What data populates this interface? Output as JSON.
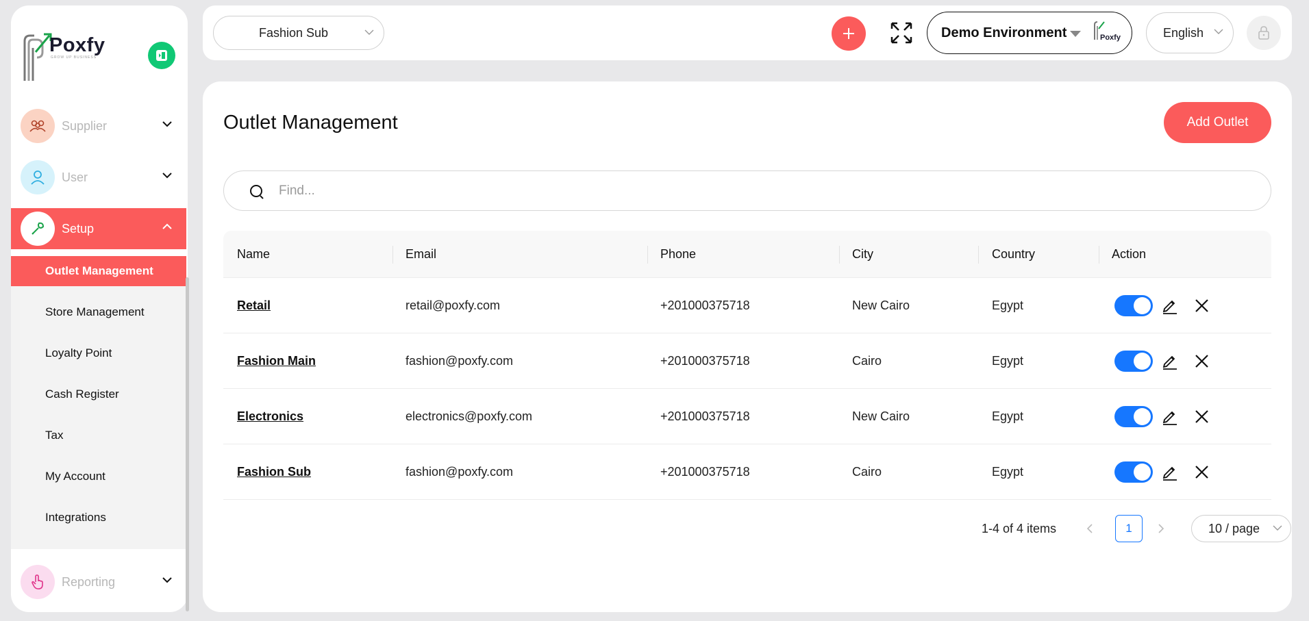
{
  "brand": {
    "name": "Poxfy",
    "tagline": "GROW UP BUSINESS"
  },
  "colors": {
    "accent": "#fb5b5b",
    "toggle_on": "#1677ff",
    "collapse": "#10c875"
  },
  "sidebar": {
    "items": [
      {
        "label": "Supplier",
        "icon": "supplier-icon"
      },
      {
        "label": "User",
        "icon": "user-icon"
      },
      {
        "label": "Setup",
        "icon": "wrench-icon"
      },
      {
        "label": "Reporting",
        "icon": "hand-pointer-icon"
      }
    ],
    "setup_sub": [
      {
        "label": "Outlet Management"
      },
      {
        "label": "Store Management"
      },
      {
        "label": "Loyalty Point"
      },
      {
        "label": "Cash Register"
      },
      {
        "label": "Tax"
      },
      {
        "label": "My Account"
      },
      {
        "label": "Integrations"
      }
    ]
  },
  "topbar": {
    "store": "Fashion Sub",
    "environment": "Demo Environment",
    "env_logo_text": "Poxfy",
    "language": "English"
  },
  "main": {
    "title": "Outlet Management",
    "add_button": "Add Outlet",
    "search_placeholder": "Find...",
    "columns": [
      "Name",
      "Email",
      "Phone",
      "City",
      "Country",
      "Action"
    ],
    "rows": [
      {
        "name": "Retail",
        "email": "retail@poxfy.com",
        "phone": "+201000375718",
        "city": "New Cairo",
        "country": "Egypt",
        "enabled": true
      },
      {
        "name": "Fashion Main",
        "email": "fashion@poxfy.com",
        "phone": "+201000375718",
        "city": "Cairo",
        "country": "Egypt",
        "enabled": true
      },
      {
        "name": "Electronics",
        "email": "electronics@poxfy.com",
        "phone": "+201000375718",
        "city": "New Cairo",
        "country": "Egypt",
        "enabled": true
      },
      {
        "name": "Fashion Sub",
        "email": "fashion@poxfy.com",
        "phone": "+201000375718",
        "city": "Cairo",
        "country": "Egypt",
        "enabled": true
      }
    ],
    "pagination": {
      "total": "1-4 of 4 items",
      "current_page": "1",
      "page_size": "10 / page"
    }
  }
}
